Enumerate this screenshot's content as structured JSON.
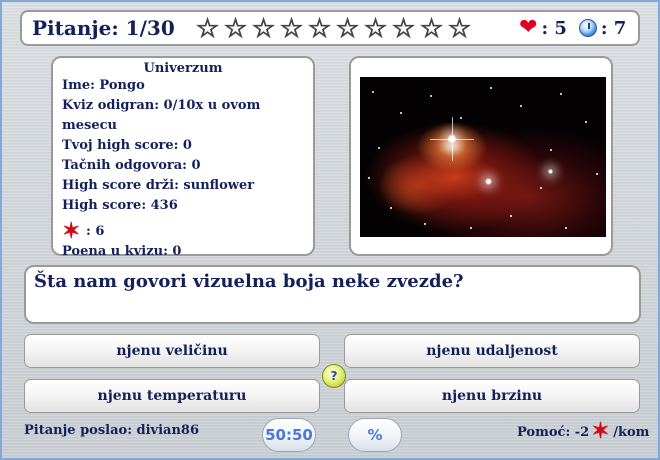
{
  "header": {
    "question_counter": "Pitanje: 1/30",
    "star_count_total": 10,
    "star_count_filled": 0,
    "lives": ": 5",
    "time": ": 7",
    "icons": {
      "star": "star-outline-icon",
      "lives": "heart-icon",
      "time": "clock-icon"
    }
  },
  "info": {
    "title": "Univerzum",
    "name": "Ime: Pongo",
    "played": "Kviz odigran: 0/10x u ovom mesecu",
    "high_score": "Tvoj high score: 0",
    "correct": "Tačnih odgovora: 0",
    "high_score_holder": "High score drži: sunflower",
    "high_score_top": "High score: 436",
    "bug_count": ": 6",
    "points": "Poena u kvizu: 0"
  },
  "question": {
    "text": "Šta nam govori vizuelna boja neke zvezde?"
  },
  "answers": [
    "njenu veličinu",
    "njenu udaljenost",
    "njenu temperaturu",
    "njenu brzinu"
  ],
  "footer": {
    "sent_by": "Pitanje poslao: divian86",
    "fifty_fifty": "50:50",
    "percent": "%",
    "help_prefix": "Pomoć: -2",
    "help_suffix": "/kom"
  },
  "colors": {
    "text": "#14205a",
    "heart": "#e00022",
    "bug": "#d10a14",
    "pill_text": "#4a7ad8",
    "frame": "#7fa9d6"
  }
}
